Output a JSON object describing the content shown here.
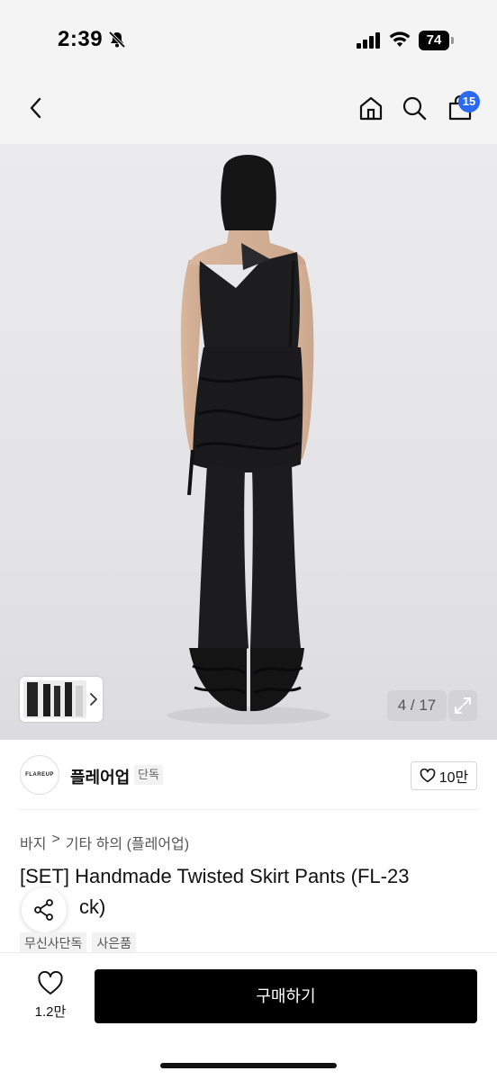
{
  "status": {
    "time": "2:39",
    "battery": "74",
    "icons": [
      "bell-off-icon",
      "signal-icon",
      "wifi-icon",
      "battery-icon"
    ]
  },
  "header": {
    "icons": [
      "chevron-left-icon",
      "home-icon",
      "search-icon",
      "cart-icon"
    ],
    "cart_count": "15",
    "accent": "#2a6af2"
  },
  "gallery": {
    "counter": "4 / 17",
    "icons": [
      "chevron-right-icon",
      "expand-icon"
    ]
  },
  "brand": {
    "logo_text": "FLAREUP",
    "name": "플레어업",
    "badge": "단독",
    "likes": "10만"
  },
  "breadcrumb": {
    "items": [
      "바지",
      "기타 하의 (플레어업)"
    ],
    "separator": ">"
  },
  "product": {
    "title_line1": "[SET] Handmade Twisted Skirt Pants (FL-23",
    "title_line2": "ck)",
    "tags": [
      "무신사단독",
      "사은품"
    ]
  },
  "bottom_bar": {
    "wish_count": "1.2만",
    "buy_label": "구매하기",
    "buy_color": "#000000"
  }
}
